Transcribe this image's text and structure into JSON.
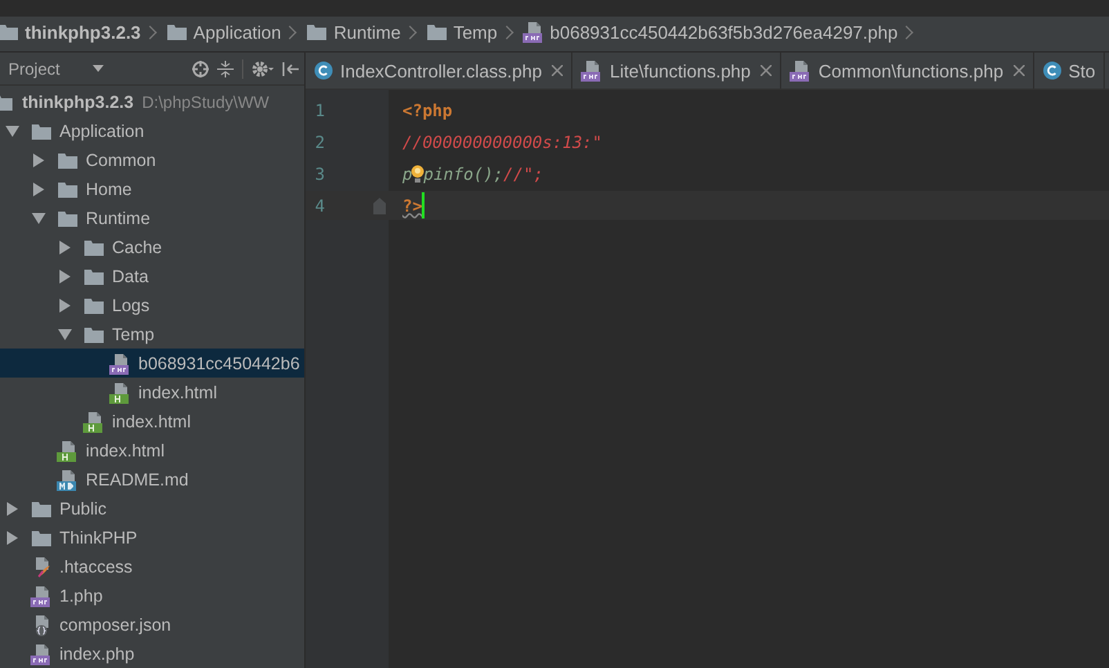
{
  "breadcrumbs": [
    {
      "kind": "project",
      "label": "thinkphp3.2.3"
    },
    {
      "kind": "folder",
      "label": "Application"
    },
    {
      "kind": "folder",
      "label": "Runtime"
    },
    {
      "kind": "folder",
      "label": "Temp"
    },
    {
      "kind": "php",
      "label": "b068931cc450442b63f5b3d276ea4297.php"
    }
  ],
  "project_panel": {
    "title": "Project",
    "root": {
      "name": "thinkphp3.2.3",
      "path": "D:\\phpStudy\\WW"
    },
    "tree": [
      {
        "kind": "folder",
        "name": "Application",
        "expanded": true,
        "selected": false,
        "children": [
          {
            "kind": "folder",
            "name": "Common",
            "expanded": false,
            "selected": false
          },
          {
            "kind": "folder",
            "name": "Home",
            "expanded": false,
            "selected": false
          },
          {
            "kind": "folder",
            "name": "Runtime",
            "expanded": true,
            "selected": false,
            "children": [
              {
                "kind": "folder",
                "name": "Cache",
                "expanded": false,
                "selected": false
              },
              {
                "kind": "folder",
                "name": "Data",
                "expanded": false,
                "selected": false
              },
              {
                "kind": "folder",
                "name": "Logs",
                "expanded": false,
                "selected": false
              },
              {
                "kind": "folder",
                "name": "Temp",
                "expanded": true,
                "selected": false,
                "children": [
                  {
                    "kind": "php",
                    "name": "b068931cc450442b6",
                    "selected": true
                  },
                  {
                    "kind": "html",
                    "name": "index.html",
                    "selected": false
                  }
                ]
              },
              {
                "kind": "html",
                "name": "index.html",
                "selected": false
              }
            ]
          },
          {
            "kind": "html",
            "name": "index.html",
            "selected": false
          },
          {
            "kind": "md",
            "name": "README.md",
            "selected": false
          }
        ]
      },
      {
        "kind": "folder",
        "name": "Public",
        "expanded": false,
        "selected": false
      },
      {
        "kind": "folder",
        "name": "ThinkPHP",
        "expanded": false,
        "selected": false
      },
      {
        "kind": "htaccess",
        "name": ".htaccess",
        "selected": false
      },
      {
        "kind": "php",
        "name": "1.php",
        "selected": false
      },
      {
        "kind": "json",
        "name": "composer.json",
        "selected": false
      },
      {
        "kind": "php",
        "name": "index.php",
        "selected": false
      }
    ]
  },
  "tabs": [
    {
      "kind": "class",
      "label": "IndexController.class.php",
      "closable": true
    },
    {
      "kind": "php",
      "label": "Lite\\functions.php",
      "closable": true
    },
    {
      "kind": "php",
      "label": "Common\\functions.php",
      "closable": true
    },
    {
      "kind": "class",
      "label": "Sto",
      "closable": false
    }
  ],
  "editor": {
    "lines": [
      {
        "number": "1",
        "current": false,
        "tokens": [
          {
            "kind": "keyword",
            "text": "<?php"
          }
        ]
      },
      {
        "number": "2",
        "current": false,
        "tokens": [
          {
            "kind": "comment",
            "text": "//000000000000s:13:\""
          }
        ]
      },
      {
        "number": "3",
        "current": false,
        "tokens": [
          {
            "kind": "call",
            "text": "p"
          },
          {
            "kind": "bulb"
          },
          {
            "kind": "call",
            "text": "pinfo();"
          },
          {
            "kind": "comment",
            "text": "//\";"
          }
        ]
      },
      {
        "number": "4",
        "current": true,
        "tokens": [
          {
            "kind": "keyword",
            "text": "?>",
            "warning": true
          }
        ]
      }
    ]
  }
}
